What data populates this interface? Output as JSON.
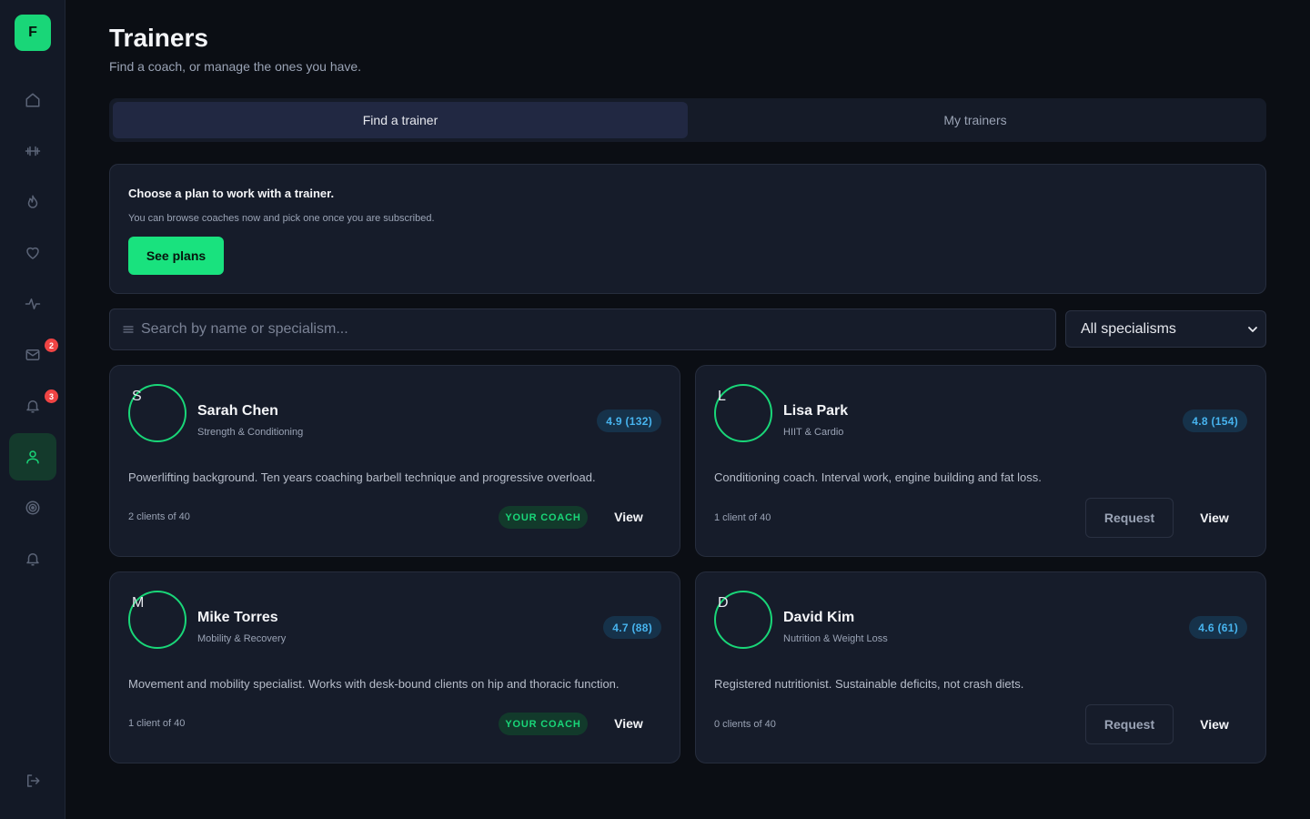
{
  "sidebar": {
    "logo": "F",
    "items": [
      {
        "icon": "home-icon"
      },
      {
        "icon": "dumbbell-icon"
      },
      {
        "icon": "flame-icon"
      },
      {
        "icon": "heart-icon"
      },
      {
        "icon": "activity-icon"
      },
      {
        "icon": "mail-icon",
        "badge": "2"
      },
      {
        "icon": "bell-icon",
        "badge": "3"
      },
      {
        "icon": "user-icon",
        "active": true
      },
      {
        "icon": "target-icon"
      },
      {
        "icon": "notification-icon"
      }
    ],
    "logout_icon": "logout-icon"
  },
  "header": {
    "title": "Trainers",
    "subtitle": "Find a coach, or manage the ones you have."
  },
  "tabs": [
    {
      "label": "Find a trainer",
      "active": true
    },
    {
      "label": "My trainers",
      "active": false
    }
  ],
  "plan_banner": {
    "title": "Choose a plan to work with a trainer.",
    "subtitle": "You can browse coaches now and pick one once you are subscribed.",
    "button_label": "See plans"
  },
  "search": {
    "placeholder": "Search by name or specialism...",
    "value": ""
  },
  "filter": {
    "selected": "All specialisms"
  },
  "trainers": [
    {
      "initial": "S",
      "name": "Sarah Chen",
      "specialism": "Strength & Conditioning",
      "rating": "4.9 (132)",
      "bio": "Powerlifting background. Ten years coaching barbell technique and progressive overload.",
      "clients": "2 clients of 40",
      "badge": "YOUR COACH",
      "view_label": "View"
    },
    {
      "initial": "L",
      "name": "Lisa Park",
      "specialism": "HIIT & Cardio",
      "rating": "4.8 (154)",
      "bio": "Conditioning coach. Interval work, engine building and fat loss.",
      "clients": "1 client of 40",
      "request_label": "Request",
      "view_label": "View"
    },
    {
      "initial": "M",
      "name": "Mike Torres",
      "specialism": "Mobility & Recovery",
      "rating": "4.7 (88)",
      "bio": "Movement and mobility specialist. Works with desk-bound clients on hip and thoracic function.",
      "clients": "1 client of 40",
      "badge": "YOUR COACH",
      "view_label": "View"
    },
    {
      "initial": "D",
      "name": "David Kim",
      "specialism": "Nutrition & Weight Loss",
      "rating": "4.6 (61)",
      "bio": "Registered nutritionist. Sustainable deficits, not crash diets.",
      "clients": "0 clients of 40",
      "request_label": "Request",
      "view_label": "View"
    }
  ],
  "colors": {
    "accent": "#19d678",
    "background": "#0b0e14",
    "card": "#161c2a",
    "rating_text": "#47b4ef",
    "badge_alert": "#ef4444"
  }
}
